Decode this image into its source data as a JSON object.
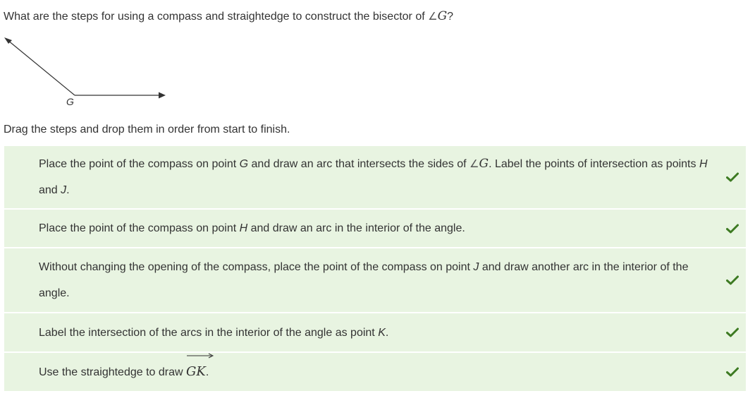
{
  "question": {
    "prefix": "What are the steps for using a compass and straightedge to construct the bisector of ",
    "angle_symbol": "∠",
    "angle_var": "G",
    "suffix": "?"
  },
  "figure": {
    "vertex_label": "G"
  },
  "instructions": "Drag the steps and drop them in order from start to finish.",
  "steps": [
    {
      "t1": "Place the point of the compass on point ",
      "v1": "G",
      "t2": " and draw an arc that intersects the sides of ",
      "angle_symbol": "∠",
      "angle_var": "G",
      "t3": ". Label the points of intersection as points ",
      "v2": "H",
      "t4": " and ",
      "v3": "J",
      "t5": ".",
      "status": "correct"
    },
    {
      "t1": "Place the point of the compass on point ",
      "v1": "H",
      "t2": " and draw an arc in the interior of the angle.",
      "status": "correct"
    },
    {
      "t1": "Without changing the opening of the compass, place the point of the compass on point ",
      "v1": "J",
      "t2": " and draw another arc in the interior of the angle.",
      "status": "correct"
    },
    {
      "t1": "Label the intersection of the arcs in the interior of the angle as point ",
      "v1": "K",
      "t2": ".",
      "status": "correct"
    },
    {
      "t1": "Use the straightedge to draw ",
      "ray": "GK",
      "t2": ".",
      "status": "correct"
    }
  ],
  "colors": {
    "step_background": "#e8f4e1",
    "check": "#3d7a22",
    "text": "#333333"
  },
  "icons": {
    "status_correct": "checkmark-icon"
  }
}
